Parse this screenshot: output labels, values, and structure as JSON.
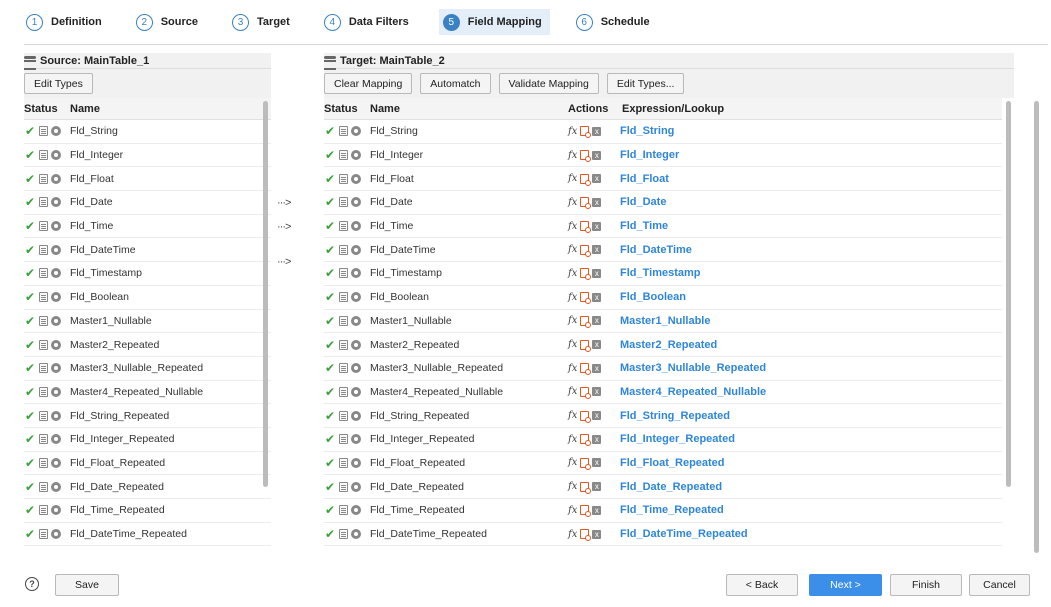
{
  "steps": [
    {
      "num": "1",
      "label": "Definition"
    },
    {
      "num": "2",
      "label": "Source"
    },
    {
      "num": "3",
      "label": "Target"
    },
    {
      "num": "4",
      "label": "Data Filters"
    },
    {
      "num": "5",
      "label": "Field Mapping"
    },
    {
      "num": "6",
      "label": "Schedule"
    }
  ],
  "active_step": "5",
  "source": {
    "title": "Source: MainTable_1",
    "edit_types": "Edit Types",
    "col_status": "Status",
    "col_name": "Name"
  },
  "target": {
    "title": "Target: MainTable_2",
    "clear_mapping": "Clear Mapping",
    "automatch": "Automatch",
    "validate_mapping": "Validate Mapping",
    "edit_types": "Edit Types...",
    "col_status": "Status",
    "col_name": "Name",
    "col_actions": "Actions",
    "col_expression": "Expression/Lookup"
  },
  "fields": [
    "Fld_String",
    "Fld_Integer",
    "Fld_Float",
    "Fld_Date",
    "Fld_Time",
    "Fld_DateTime",
    "Fld_Timestamp",
    "Fld_Boolean",
    "Master1_Nullable",
    "Master2_Repeated",
    "Master3_Nullable_Repeated",
    "Master4_Repeated_Nullable",
    "Fld_String_Repeated",
    "Fld_Integer_Repeated",
    "Fld_Float_Repeated",
    "Fld_Date_Repeated",
    "Fld_Time_Repeated",
    "Fld_DateTime_Repeated"
  ],
  "icons": {
    "status": "check-icon",
    "field": "document-icon",
    "settings": "gear-icon",
    "expression": "fx-icon",
    "lookup": "lookup-icon",
    "remove": "close-box-icon",
    "map_arrow": "map-arrow-icon"
  },
  "glyphs": {
    "check": "✔",
    "fx": "fx",
    "x": "x",
    "arrow": "···>",
    "help": "?"
  },
  "colors": {
    "accent": "#3b82c4",
    "link": "#2f86d8",
    "primary_button": "#3b8fe8",
    "lookup": "#e8541e",
    "check": "#3aa03a"
  },
  "footer": {
    "save": "Save",
    "back": "< Back",
    "next": "Next >",
    "finish": "Finish",
    "cancel": "Cancel"
  }
}
